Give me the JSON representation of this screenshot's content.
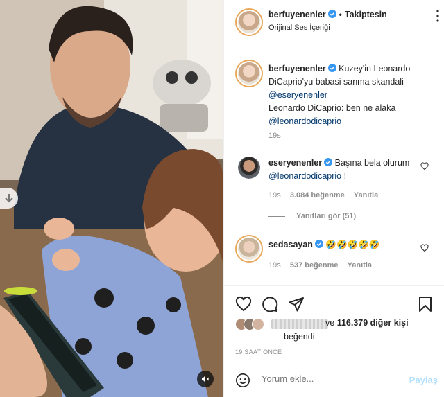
{
  "header": {
    "username": "berfuyenenler",
    "separator": "•",
    "follow_label": "Takiptesin",
    "audio": "Orijinal Ses İçeriği"
  },
  "caption": {
    "username": "berfuyenenler",
    "text": "Kuzey'in Leonardo DiCaprio'yu babasi sanma skandali",
    "mention1": "@eseryenenler",
    "line2": "Leonardo DiCaprio: ben ne alaka",
    "mention2": "@leonardodicaprio",
    "time": "19s"
  },
  "comments": [
    {
      "username": "eseryenenler",
      "text": "Başına bela olurum",
      "mention": "@leonardodicaprio",
      "suffix": " !",
      "time": "19s",
      "likes": "3.084 beğenme",
      "reply": "Yanıtla",
      "view_replies": "Yanıtları gör (51)"
    },
    {
      "username": "sedasayan",
      "text": "🤣🤣🤣🤣🤣",
      "time": "19s",
      "likes": "537 beğenme",
      "reply": "Yanıtla"
    }
  ],
  "likes": {
    "prefix": "ve",
    "count": "116.379 diğer kişi",
    "suffix": "beğendi"
  },
  "posted_ago": "19 SAAT ÖNCE",
  "add_comment": {
    "placeholder": "Yorum ekle...",
    "post_label": "Paylaş"
  },
  "icons": {
    "heart": "heart-icon",
    "comment": "comment-icon",
    "share": "share-icon",
    "save": "bookmark-icon",
    "emoji": "emoji-icon",
    "mute": "speaker-muted-icon",
    "scroll": "arrow-down-icon"
  },
  "colors": {
    "verified": "#3897f0",
    "link": "#00376b",
    "muted_text": "#8e8e8e",
    "post_button": "#b2dffc",
    "story_ring": "#e8a85a"
  }
}
